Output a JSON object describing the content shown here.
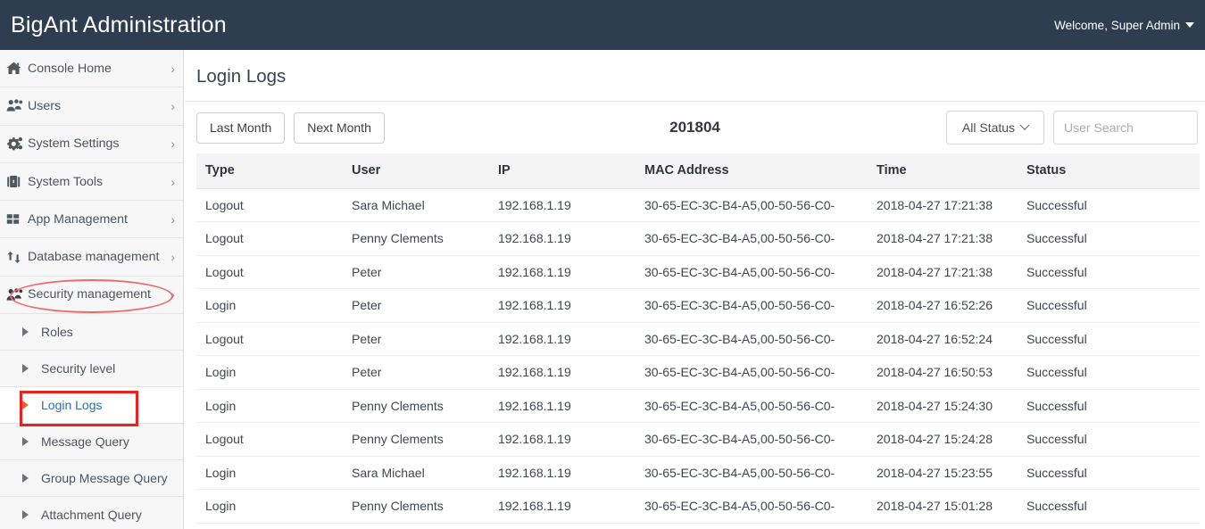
{
  "header": {
    "app_title": "BigAnt Administration",
    "welcome_label": "Welcome, Super Admin",
    "caret_icon": "caret-down-icon",
    "background_color": "#2e3e50"
  },
  "sidebar": {
    "items": [
      {
        "label": "Console Home",
        "icon": "home-icon",
        "chevron": "›"
      },
      {
        "label": "Users",
        "icon": "users-icon",
        "chevron": "›"
      },
      {
        "label": "System Settings",
        "icon": "gears-icon",
        "chevron": "›"
      },
      {
        "label": "System Tools",
        "icon": "briefcase-icon",
        "chevron": "›"
      },
      {
        "label": "App Management",
        "icon": "grid-icon",
        "chevron": "›"
      },
      {
        "label": "Database management",
        "icon": "exchange-icon",
        "chevron": "›"
      },
      {
        "label": "Security management",
        "icon": "users-icon",
        "chevron": "›"
      }
    ],
    "sub_items": [
      {
        "label": "Roles",
        "active": false
      },
      {
        "label": "Security level",
        "active": false
      },
      {
        "label": "Login Logs",
        "active": true
      },
      {
        "label": "Message Query",
        "active": false
      },
      {
        "label": "Group Message Query",
        "active": false
      },
      {
        "label": "Attachment Query",
        "active": false
      }
    ],
    "annotation_color": "#ec2020",
    "active_link_color": "#2f6fb5"
  },
  "main": {
    "page_title": "Login Logs",
    "toolbar": {
      "last_month_label": "Last Month",
      "next_month_label": "Next Month",
      "month_label": "201804",
      "status_filter_label": "All Status",
      "status_filter_icon": "chevron-down-icon",
      "search_placeholder": "User Search",
      "search_value": ""
    },
    "table": {
      "columns": [
        "Type",
        "User",
        "IP",
        "MAC Address",
        "Time",
        "Status"
      ],
      "rows": [
        {
          "type": "Logout",
          "user": "Sara Michael",
          "ip": "192.168.1.19",
          "mac": "30-65-EC-3C-B4-A5,00-50-56-C0-",
          "time": "2018-04-27 17:21:38",
          "status": "Successful"
        },
        {
          "type": "Logout",
          "user": "Penny Clements",
          "ip": "192.168.1.19",
          "mac": "30-65-EC-3C-B4-A5,00-50-56-C0-",
          "time": "2018-04-27 17:21:38",
          "status": "Successful"
        },
        {
          "type": "Logout",
          "user": "Peter",
          "ip": "192.168.1.19",
          "mac": "30-65-EC-3C-B4-A5,00-50-56-C0-",
          "time": "2018-04-27 17:21:38",
          "status": "Successful"
        },
        {
          "type": "Login",
          "user": "Peter",
          "ip": "192.168.1.19",
          "mac": "30-65-EC-3C-B4-A5,00-50-56-C0-",
          "time": "2018-04-27 16:52:26",
          "status": "Successful"
        },
        {
          "type": "Logout",
          "user": "Peter",
          "ip": "192.168.1.19",
          "mac": "30-65-EC-3C-B4-A5,00-50-56-C0-",
          "time": "2018-04-27 16:52:24",
          "status": "Successful"
        },
        {
          "type": "Login",
          "user": "Peter",
          "ip": "192.168.1.19",
          "mac": "30-65-EC-3C-B4-A5,00-50-56-C0-",
          "time": "2018-04-27 16:50:53",
          "status": "Successful"
        },
        {
          "type": "Login",
          "user": "Penny Clements",
          "ip": "192.168.1.19",
          "mac": "30-65-EC-3C-B4-A5,00-50-56-C0-",
          "time": "2018-04-27 15:24:30",
          "status": "Successful"
        },
        {
          "type": "Logout",
          "user": "Penny Clements",
          "ip": "192.168.1.19",
          "mac": "30-65-EC-3C-B4-A5,00-50-56-C0-",
          "time": "2018-04-27 15:24:28",
          "status": "Successful"
        },
        {
          "type": "Login",
          "user": "Sara Michael",
          "ip": "192.168.1.19",
          "mac": "30-65-EC-3C-B4-A5,00-50-56-C0-",
          "time": "2018-04-27 15:23:55",
          "status": "Successful"
        },
        {
          "type": "Login",
          "user": "Penny Clements",
          "ip": "192.168.1.19",
          "mac": "30-65-EC-3C-B4-A5,00-50-56-C0-",
          "time": "2018-04-27 15:01:28",
          "status": "Successful"
        }
      ],
      "status_success_color": "#0a8033"
    }
  }
}
